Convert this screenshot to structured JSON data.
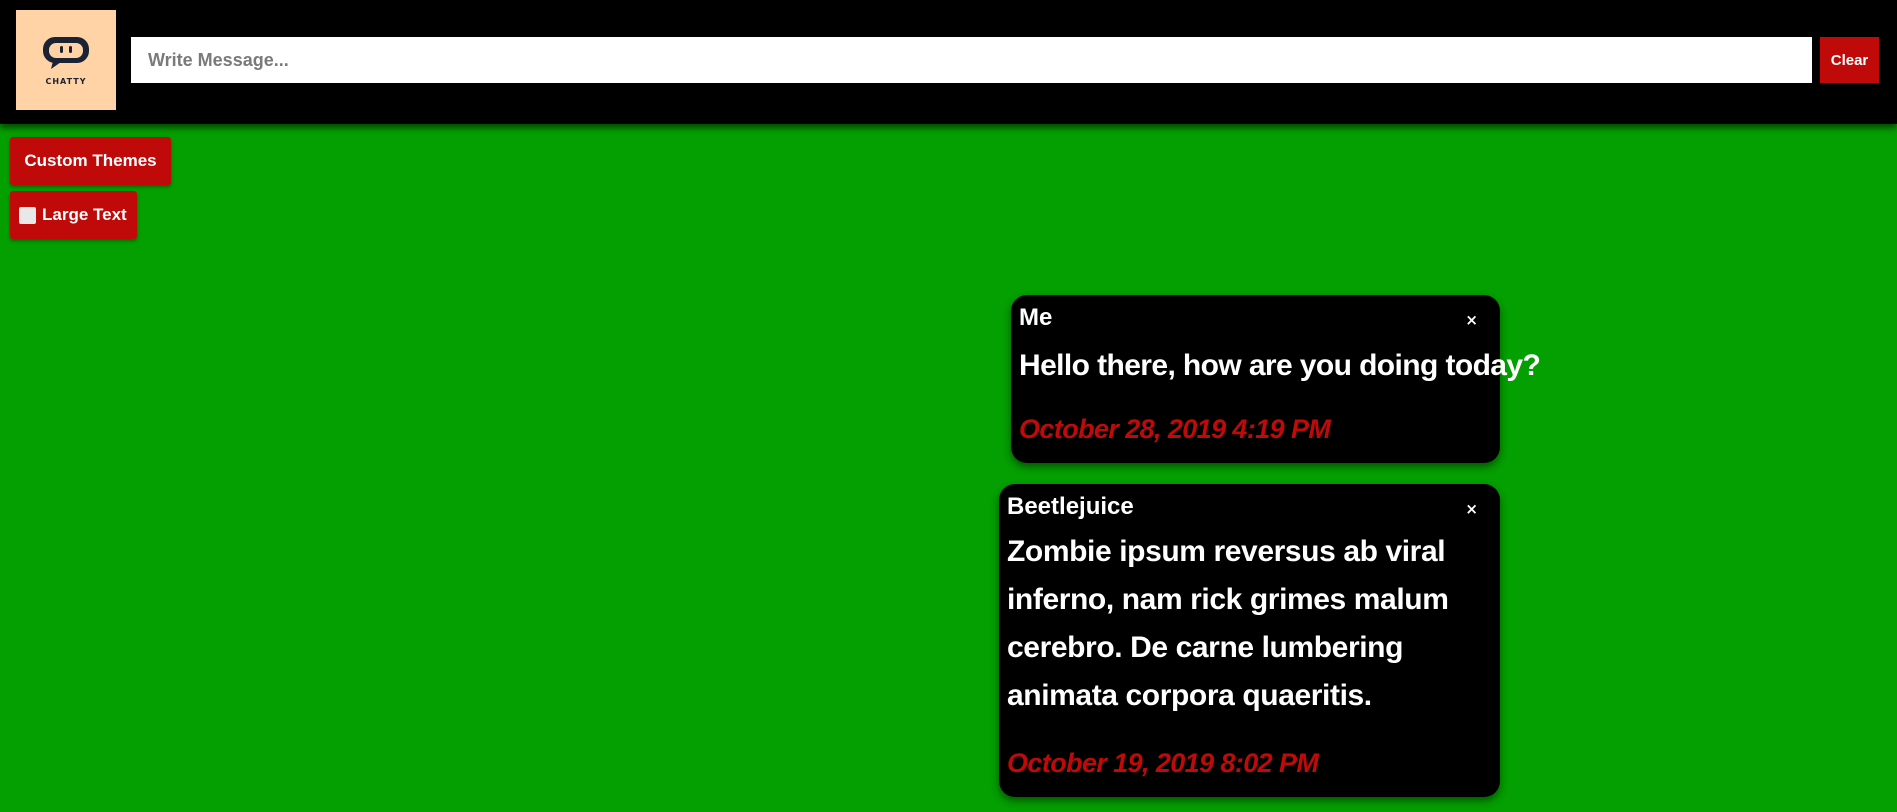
{
  "app": {
    "logo_text": "CHATTY",
    "input_placeholder": "Write Message...",
    "input_value": "",
    "clear_label": "Clear",
    "colors": {
      "background": "#049f00",
      "accent": "#c00a0a",
      "topbar": "#000000",
      "logo_bg": "#ffd3a5"
    }
  },
  "controls": {
    "custom_themes_label": "Custom Themes",
    "large_text_label": "Large Text",
    "large_text_checked": false
  },
  "messages": [
    {
      "sender": "Me",
      "text": "Hello there, how are you doing today?",
      "timestamp": "October 28, 2019 4:19 PM",
      "close": "×"
    },
    {
      "sender": "Beetlejuice",
      "text": "Zombie ipsum reversus ab viral inferno, nam rick grimes malum cerebro. De carne lumbering animata corpora quaeritis.",
      "timestamp": "October 19, 2019 8:02 PM",
      "close": "×"
    }
  ]
}
